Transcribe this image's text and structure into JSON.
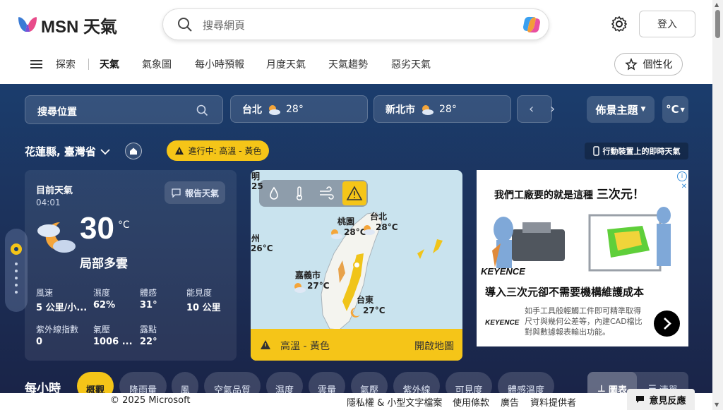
{
  "header": {
    "logo_text": "MSN 天氣",
    "search_placeholder": "搜尋網頁",
    "login_label": "登入"
  },
  "nav": {
    "items": [
      "探索",
      "天氣",
      "氣象圖",
      "每小時預報",
      "月度天氣",
      "天氣趨勢",
      "惡劣天氣"
    ],
    "active": "天氣",
    "personalize_label": "個性化"
  },
  "toolbar": {
    "location_search_placeholder": "搜尋位置",
    "cities": [
      {
        "name": "台北",
        "temp": "28°"
      },
      {
        "name": "新北市",
        "temp": "28°"
      }
    ],
    "theme_label": "佈景主題",
    "unit_label": "°C"
  },
  "location": {
    "title": "花蓮縣, 臺灣省",
    "alert_label": "進行中: 高溫 - 黃色",
    "mobile_link": "行動裝置上的即時天氣"
  },
  "current": {
    "title": "目前天氣",
    "time": "04:01",
    "report_label": "報告天氣",
    "temp": "30",
    "unit": "°C",
    "condition": "局部多雲",
    "stats": [
      {
        "label": "風速",
        "value": "5 公里/小..."
      },
      {
        "label": "濕度",
        "value": "62%"
      },
      {
        "label": "體感",
        "value": "31°"
      },
      {
        "label": "能見度",
        "value": "10 公里"
      },
      {
        "label": "紫外線指數",
        "value": "0"
      },
      {
        "label": "氣壓",
        "value": "1006 ..."
      },
      {
        "label": "露點",
        "value": "22°"
      }
    ]
  },
  "map": {
    "labels": [
      {
        "name": "明",
        "temp": "25"
      },
      {
        "name": "州",
        "temp": "26°C"
      },
      {
        "name": "桃園",
        "temp": "28°C"
      },
      {
        "name": "台北",
        "temp": "28°C"
      },
      {
        "name": "嘉義市",
        "temp": "27°C"
      },
      {
        "name": "台東",
        "temp": "27°C"
      }
    ],
    "alert_text": "高溫 - 黃色",
    "open_map_label": "開啟地圖",
    "alert_color": "#f5c518"
  },
  "ad": {
    "headline": "我們工廠要的就是這種",
    "headline_emphasis": "三次元！",
    "brand": "KEYENCE",
    "subhead": "導入三次元卻不需要機構維護成本",
    "body": "如手工具般輕觸工件即可精準取得尺寸與幾何公差等，內建CAD檔比對與數據報表輸出功能。"
  },
  "hourly": {
    "title": "每小時",
    "tabs": [
      "概觀",
      "降雨量",
      "風",
      "空氣品質",
      "濕度",
      "雲量",
      "氣壓",
      "紫外線",
      "可見度",
      "體感溫度"
    ],
    "active_tab": "概觀",
    "view_chart": "圖表",
    "view_list": "清單"
  },
  "footer": {
    "copyright": "© 2025 Microsoft",
    "links": [
      "隱私權 & 小型文字檔案",
      "使用條款",
      "廣告",
      "資料提供者"
    ],
    "feedback_label": "意見反應"
  }
}
